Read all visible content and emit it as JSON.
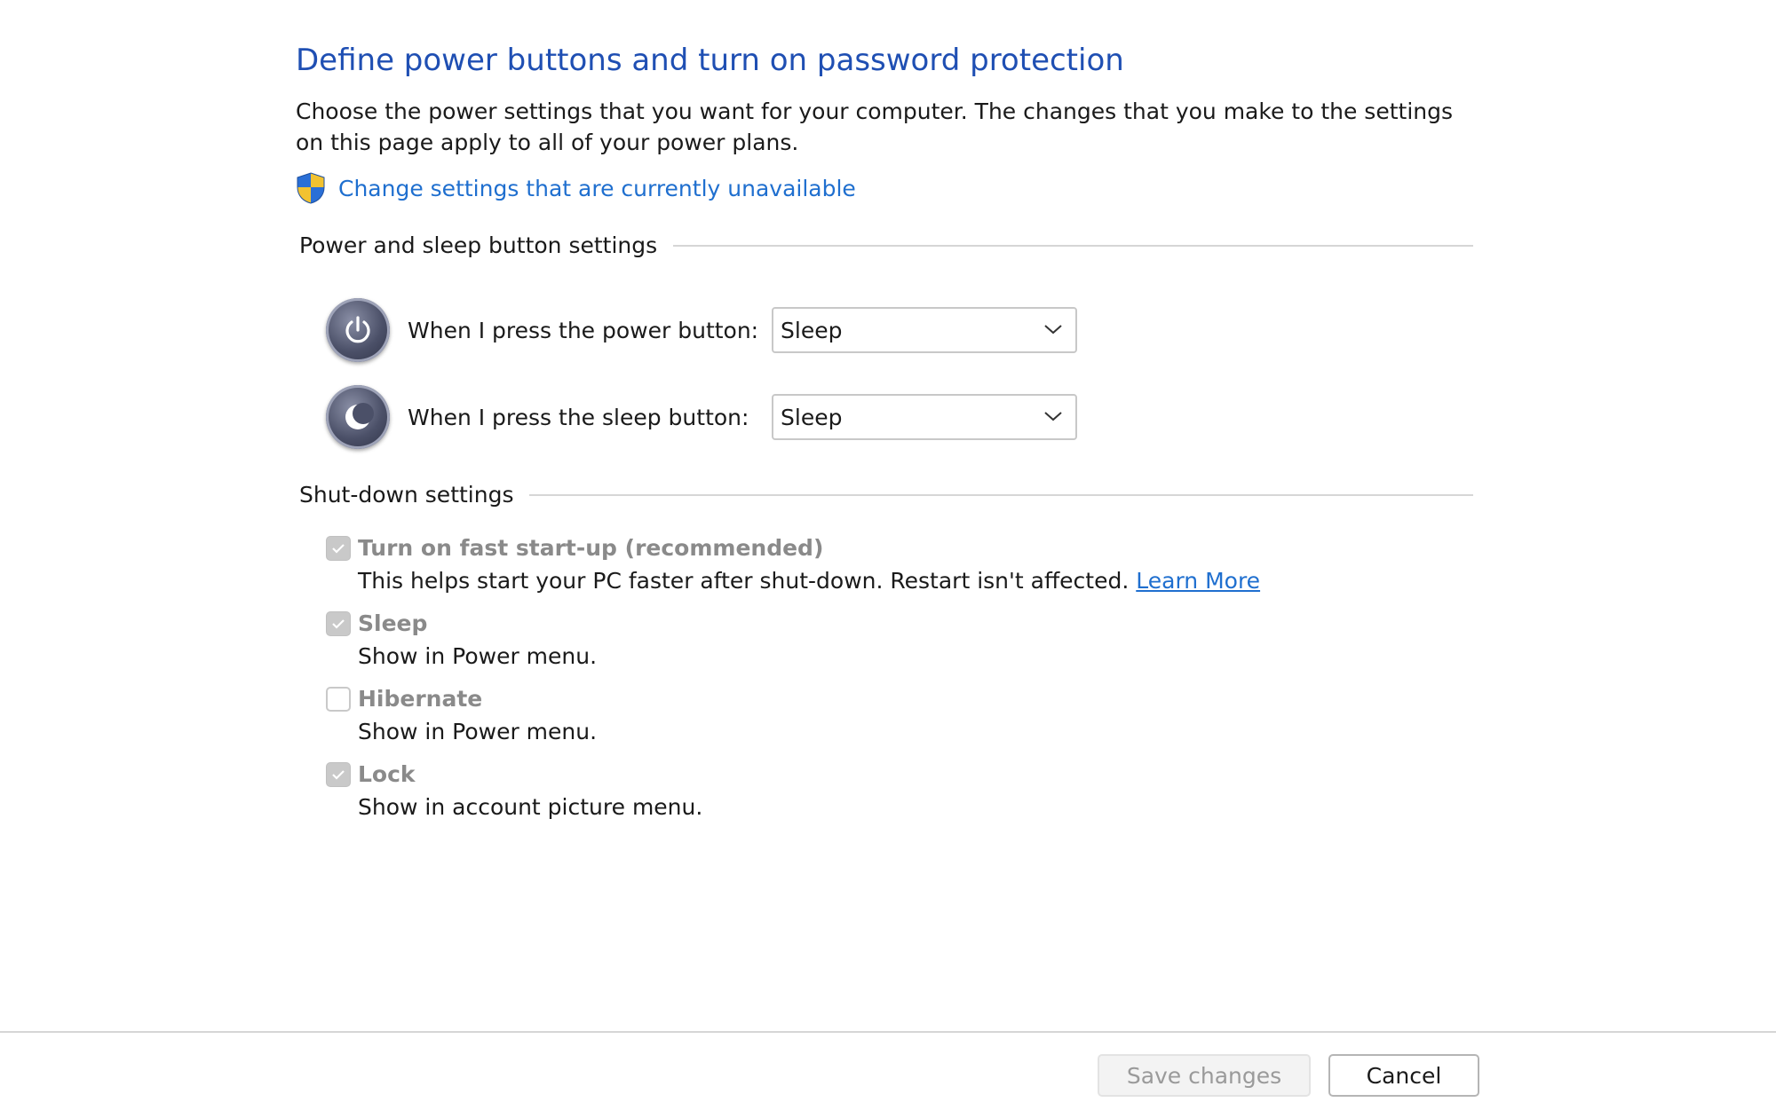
{
  "page": {
    "title": "Define power buttons and turn on password protection",
    "description": "Choose the power settings that you want for your computer. The changes that you make to the settings on this page apply to all of your power plans.",
    "change_settings_link": "Change settings that are currently unavailable",
    "change_settings_icon": "uac-shield-icon"
  },
  "power_sleep": {
    "header": "Power and sleep button settings",
    "rows": [
      {
        "label": "When I press the power button:",
        "value": "Sleep",
        "icon": "power-button-icon"
      },
      {
        "label": "When I press the sleep button:",
        "value": "Sleep",
        "icon": "sleep-button-icon"
      }
    ]
  },
  "shutdown": {
    "header": "Shut-down settings",
    "items": [
      {
        "title": "Turn on fast start-up (recommended)",
        "checked": true,
        "subtitle": "This helps start your PC faster after shut-down. Restart isn't affected.",
        "link": "Learn More"
      },
      {
        "title": "Sleep",
        "checked": true,
        "subtitle": "Show in Power menu."
      },
      {
        "title": "Hibernate",
        "checked": false,
        "subtitle": "Show in Power menu."
      },
      {
        "title": "Lock",
        "checked": true,
        "subtitle": "Show in account picture menu."
      }
    ]
  },
  "buttons": {
    "save": "Save changes",
    "cancel": "Cancel"
  },
  "colors": {
    "title": "#1f4fb3",
    "link": "#1f6fcf",
    "disabled_text": "#8a8a8a"
  }
}
